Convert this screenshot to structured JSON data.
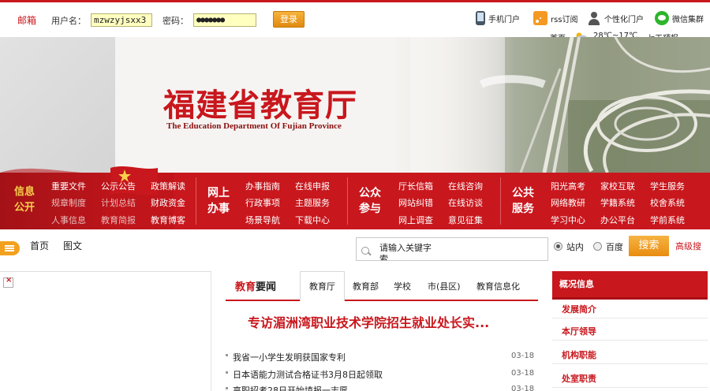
{
  "topbar": {
    "mail_label": "邮箱",
    "username_label": "用户名：",
    "username_value": "mzwzyjsxx3",
    "password_label": "密码：",
    "password_value": "●●●●●●●",
    "login_label": "登录",
    "links": [
      {
        "label": "手机门户",
        "icon": "mobile-phone-icon"
      },
      {
        "label": "rss订阅",
        "icon": "rss-icon"
      },
      {
        "label": "个性化门户",
        "icon": "user-icon"
      },
      {
        "label": "微信集群",
        "icon": "wechat-icon"
      }
    ],
    "weather": {
      "city": "首页",
      "icon": "partly-cloudy-icon",
      "temp": "28℃~17℃",
      "forecast": "七天预报"
    }
  },
  "banner": {
    "title": "福建省教育厅",
    "subtitle": "The Education Department Of Fujian Province"
  },
  "nav": {
    "group1": {
      "title": "信息公开",
      "rows": [
        [
          "重要文件",
          "公示公告",
          "政策解读"
        ],
        [
          "规章制度",
          "计划总结",
          "财政资金"
        ],
        [
          "人事信息",
          "教育简报",
          "教育博客"
        ]
      ]
    },
    "group2": {
      "title": "网上办事",
      "rows": [
        [
          "办事指南",
          "在线申报"
        ],
        [
          "行政事项",
          "主题服务"
        ],
        [
          "场景导航",
          "下载中心"
        ]
      ]
    },
    "group3": {
      "title": "公众参与",
      "rows": [
        [
          "厅长信箱",
          "在线咨询"
        ],
        [
          "网站纠错",
          "在线访谈"
        ],
        [
          "网上调查",
          "意见征集"
        ]
      ]
    },
    "group4": {
      "title": "公共服务",
      "rows": [
        [
          "阳光高考",
          "家校互联",
          "学生服务"
        ],
        [
          "网络教研",
          "学籍系统",
          "校舍系统"
        ],
        [
          "学习中心",
          "办公平台",
          "学前系统"
        ]
      ]
    }
  },
  "search": {
    "crumbs": [
      "首页",
      "图文"
    ],
    "placeholder": "请输入关键字",
    "placeholder_tail": "索",
    "option_site": "站内",
    "option_baidu": "百度",
    "button": "搜索",
    "advanced": "高级搜"
  },
  "news": {
    "title_hl": "教育",
    "title_rest": "要闻",
    "tabs": [
      "教育厅",
      "教育部",
      "学校",
      "市(县区)",
      "教育信息化"
    ],
    "headline": "专访湄洲湾职业技术学院招生就业处长实...",
    "items": [
      {
        "text": "我省一小学生发明获国家专利",
        "date": "03-18"
      },
      {
        "text": "日本语能力测试合格证书3月8日起领取",
        "date": "03-18"
      },
      {
        "text": "高职招考28日开始填报一志愿",
        "date": "03-18"
      }
    ]
  },
  "sidebar": {
    "heading": "概况信息",
    "items": [
      "发展简介",
      "本厅领导",
      "机构职能",
      "处室职责"
    ]
  }
}
